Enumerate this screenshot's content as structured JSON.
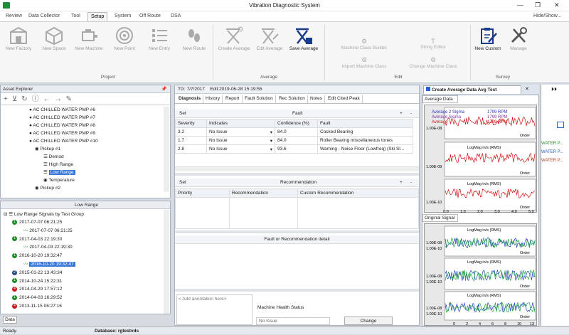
{
  "app": {
    "title": "Vibration Diagnostic System",
    "win_buttons": [
      "—",
      "❐",
      "✕"
    ],
    "help_label": "Hide/Show..."
  },
  "tabs": [
    "Review",
    "Data Collector",
    "Tool",
    "Setup",
    "System",
    "Off Route",
    "DSA"
  ],
  "ribbon": {
    "project": [
      "New Factory",
      "New Space",
      "New Machine",
      "New Point",
      "New Entry",
      "New Route"
    ],
    "average": [
      "Create Average",
      "Edit Average",
      "Save Average"
    ],
    "edit": [
      "Machine Class Builder",
      "Import Machine Class",
      "String Editor",
      "Change Machine Class"
    ],
    "survey": [
      "New Custom",
      "Manage"
    ],
    "groups": [
      "Project",
      "Average",
      "Edit",
      "Survey"
    ]
  },
  "explorer": {
    "title": "Asset Explorer",
    "tree": [
      "AC CHILLED WATER PMP #6",
      "AC CHILLED WATER PMP #7",
      "AC CHILLED WATER PMP #8",
      "AC CHILLED WATER PMP #9",
      "AC CHILLED WATER PMP #10",
      "Pickup #1",
      "Demod",
      "High Range",
      "Low Range",
      "Temperature",
      "Pickup #2"
    ],
    "section": "Low Range",
    "signals_root": "Low Range Signals by Test Group",
    "signals": [
      {
        "d": "2017-07-07 06:21:25",
        "c": "g",
        "n": "1"
      },
      {
        "d": "2017-07-07 06:21:25",
        "sub": true
      },
      {
        "d": "2017-04-03 22:19:30",
        "c": "g",
        "n": "1"
      },
      {
        "d": "2017-04-03 22:19:30",
        "sub": true
      },
      {
        "d": "2016-10-20 19:32:47",
        "c": "g",
        "n": "1"
      },
      {
        "d": "2016-10-20 19:32:47",
        "sub": true,
        "sel": true
      },
      {
        "d": "2015-01-22 13:43:34",
        "c": "b",
        "n": "2"
      },
      {
        "d": "2014-10-24 15:22:31",
        "c": "g",
        "n": "1"
      },
      {
        "d": "2014-04-29 17:57:12",
        "c": "r",
        "n": "4"
      },
      {
        "d": "2014-04-03 16:29:52",
        "c": "g",
        "n": "1"
      },
      {
        "d": "2013-11-15 06:27:16",
        "c": "r",
        "n": "4"
      }
    ],
    "data_tab": "Data"
  },
  "diag": {
    "tg": "TG: 7/7/2017",
    "edit": "Edit:2019-06-28 15:19:55",
    "tabs": [
      "Diagnosis",
      "History",
      "Report",
      "Fault Solution",
      "Rec Solution",
      "Notes",
      "Edit Cited Peak"
    ],
    "fault_hdr": {
      "set": "Set",
      "title": "Fault",
      "plus": "+",
      "minus": "-"
    },
    "fault_cols": [
      "Severity",
      "Indicates",
      "Confidence (%)",
      "Fault"
    ],
    "faults": [
      [
        "3.2",
        "No Issue",
        "84.0",
        "Cocked Bearing"
      ],
      [
        "1.7",
        "No Issue",
        "84.0",
        "Roller Bearing miscellaneous tones"
      ],
      [
        "2.8",
        "No Issue",
        "93.6",
        "Warning - Noise Floor (Lowfreq) (Ski Sl..."
      ]
    ],
    "rec_hdr": {
      "set": "Set",
      "title": "Recommendation",
      "plus": "+",
      "minus": "-"
    },
    "rec_cols": [
      "Priority",
      "Recommendation",
      "Custom Recommendation"
    ],
    "detail": "Fault or Recommendation detail",
    "annotation": "< Add annotation here>",
    "health": "Machine Health Status",
    "health_value": "No Issue",
    "change": "Change"
  },
  "avg": {
    "title": "Create Average Data Avg Test",
    "tab1": "Average Data",
    "tab2": "Original Signal",
    "legend": [
      {
        "t": "Average 2 Sigma",
        "v": "1799 RPM",
        "c": "#3030c0"
      },
      {
        "t": "Average Sigma",
        "v": "1799 RPM",
        "c": "#8030a0"
      },
      {
        "t": "Average",
        "v": "1799 RPM",
        "c": "#d01010"
      }
    ],
    "ylabel": "LogMag in/s (RMS)",
    "order": "Order",
    "y1": "1.00E-08",
    "y2": "1.00E-09",
    "y3": "1.00E-10",
    "x_ticks": [
      "0.0",
      "1.0",
      "2.0",
      "3.0",
      "4.0",
      "5.0"
    ],
    "o_ticks": [
      "0",
      "2",
      "4",
      "6",
      "8",
      "10",
      "13"
    ]
  },
  "right": {
    "items": [
      "WATER P...",
      "WATER P...",
      "WATER P..."
    ]
  },
  "status": {
    "ready": "Ready.",
    "db": "Database: rgtestvds"
  }
}
